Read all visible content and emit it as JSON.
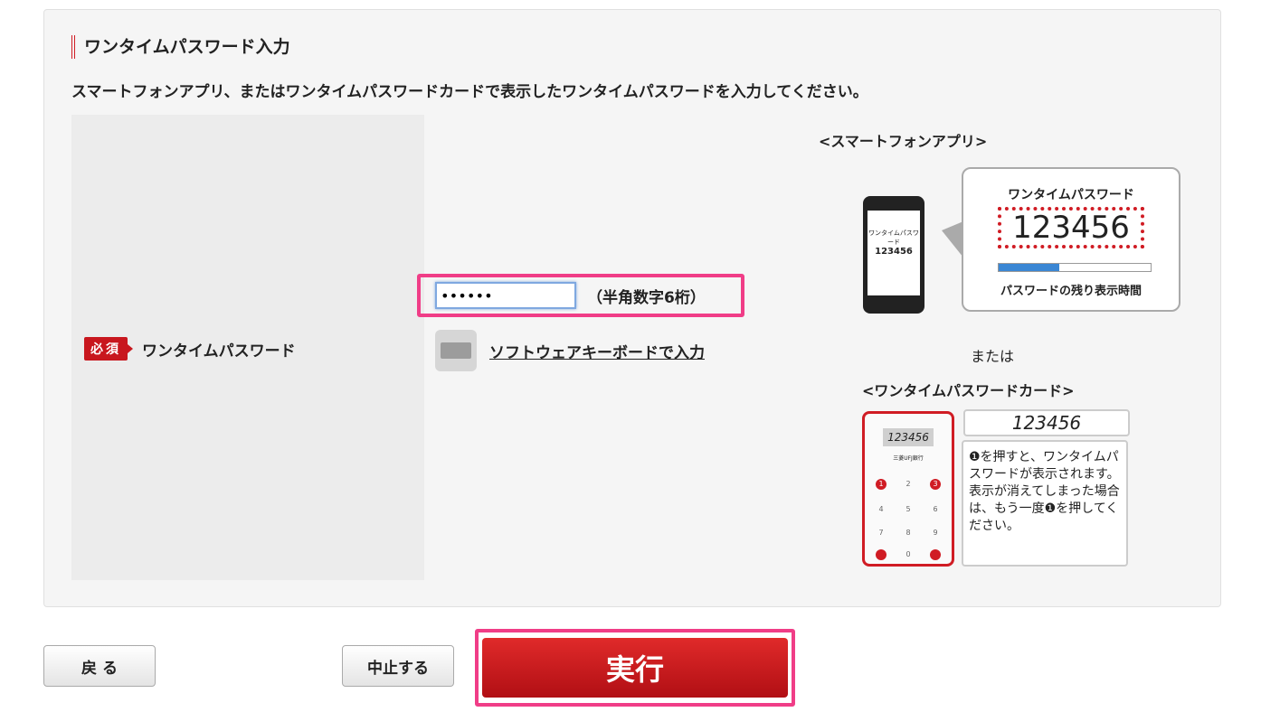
{
  "section": {
    "title": "ワンタイムパスワード入力",
    "description": "スマートフォンアプリ、またはワンタイムパスワードカードで表示したワンタイムパスワードを入力してください。"
  },
  "form": {
    "required_badge": "必須",
    "field_label": "ワンタイムパスワード",
    "password_value": "••••••",
    "hint": "（半角数字6桁）",
    "keyboard_link": "ソフトウェアキーボードで入力"
  },
  "illustration": {
    "app_title": "<スマートフォンアプリ>",
    "app_bubble_title": "ワンタイムパスワード",
    "app_code": "123456",
    "app_bubble_note": "パスワードの残り表示時間",
    "app_progress_fraction": 0.4,
    "or_text": "または",
    "card_title": "<ワンタイムパスワードカード>",
    "card_code": "123456",
    "card_display": "123456",
    "card_bank": "三菱UFJ銀行",
    "card_note": "❶を押すと、ワンタイムパスワードが表示されます。表示が消えてしまった場合は、もう一度❶を押してください。"
  },
  "buttons": {
    "back": "戻 る",
    "cancel": "中止する",
    "execute": "実行"
  },
  "colors": {
    "accent": "#d01c24",
    "highlight": "#f03d87"
  }
}
